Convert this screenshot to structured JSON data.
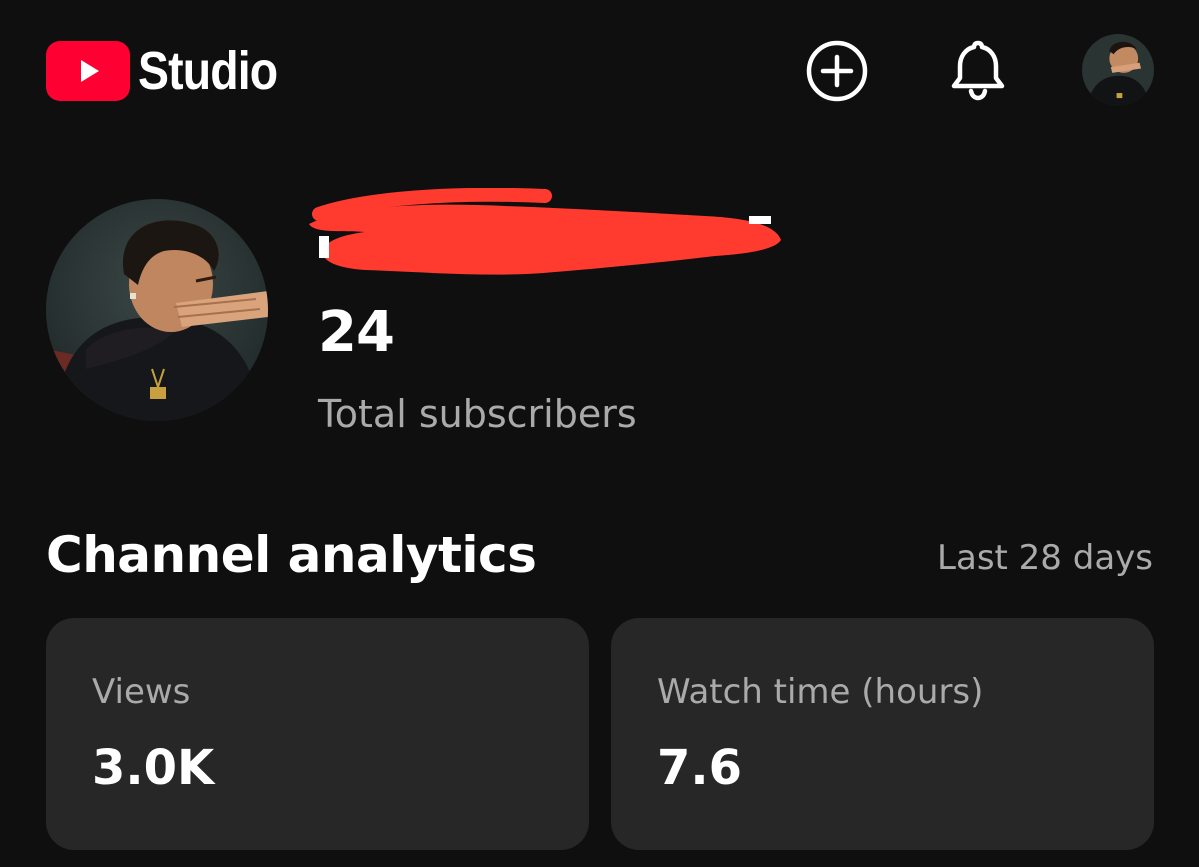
{
  "header": {
    "app_name": "Studio",
    "brand_color": "#ff0033",
    "icons": {
      "create": "create-plus-circle-icon",
      "notifications": "bell-icon",
      "account": "account-avatar"
    }
  },
  "channel": {
    "subscriber_count": "24",
    "subscriber_label": "Total subscribers"
  },
  "analytics": {
    "title": "Channel analytics",
    "range": "Last 28 days",
    "cards": [
      {
        "label": "Views",
        "value": "3.0K"
      },
      {
        "label": "Watch time (hours)",
        "value": "7.6"
      }
    ]
  },
  "colors": {
    "background": "#0f0f0f",
    "card": "#272727",
    "secondary_text": "#aaaaaa",
    "redaction": "#ff3b30"
  }
}
